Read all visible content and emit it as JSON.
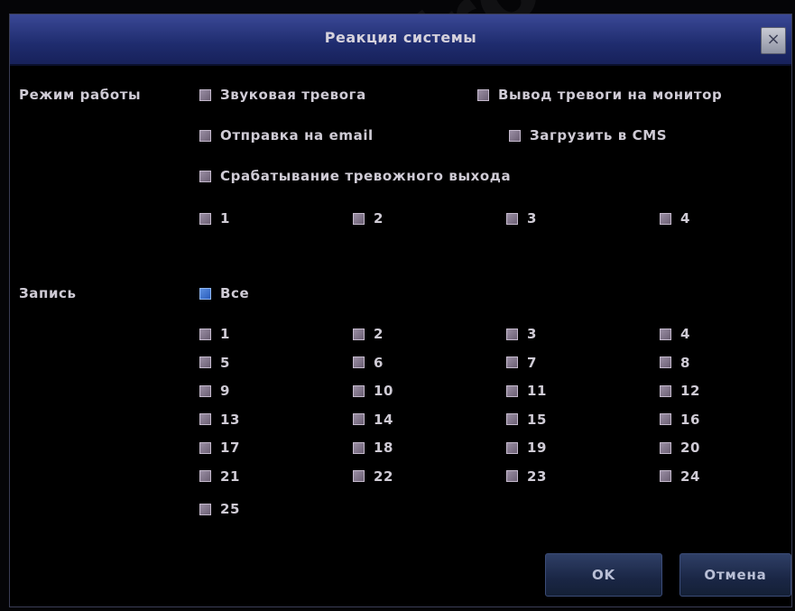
{
  "window": {
    "title": "Реакция системы",
    "close_glyph": "×"
  },
  "watermark": "www.Cyfron.ru",
  "mode": {
    "label": "Режим работы",
    "options": [
      "Звуковая тревога",
      "Вывод тревоги на монитор",
      "Отправка на email",
      "Загрузить в CMS",
      "Срабатывание тревожного выхода"
    ],
    "outputs": [
      "1",
      "2",
      "3",
      "4"
    ]
  },
  "record": {
    "label": "Запись",
    "all_label": "Все",
    "channels": [
      "1",
      "2",
      "3",
      "4",
      "5",
      "6",
      "7",
      "8",
      "9",
      "10",
      "11",
      "12",
      "13",
      "14",
      "15",
      "16",
      "17",
      "18",
      "19",
      "20",
      "21",
      "22",
      "23",
      "24",
      "25"
    ]
  },
  "buttons": {
    "ok": "OK",
    "cancel": "Отмена"
  },
  "colors": {
    "titlebar": "#2a3880",
    "background": "#000000",
    "text": "#cfcbd5",
    "checkbox": "#8a7f94",
    "checkbox_selected": "#3f78d6"
  }
}
